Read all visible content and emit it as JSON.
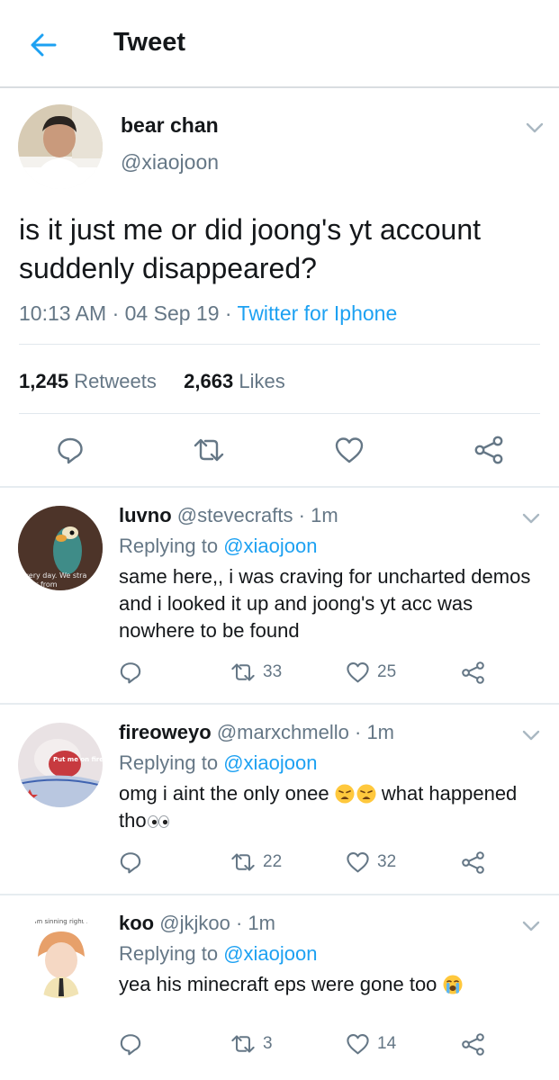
{
  "header": {
    "title": "Tweet",
    "back_icon": "arrow-left-icon"
  },
  "tweet": {
    "name": "bear chan",
    "handle": "@xiaojoon",
    "text": "is it just me or did joong's yt account suddenly disappeared?",
    "time": "10:13 AM",
    "date": "04 Sep 19",
    "source": "Twitter for Iphone",
    "retweets": "1,245",
    "retweets_label": "Retweets",
    "likes": "2,663",
    "likes_label": "Likes"
  },
  "replies": [
    {
      "name": "luvno",
      "handle": "@stevecrafts",
      "time": "1m",
      "replying_label": "Replying to",
      "replying_to": "@xiaojoon",
      "text": "same here,, i was craving for uncharted demos and i looked it up and joong's yt acc was nowhere to be found",
      "avatar_text": "Every day. We stra",
      "avatar_text2": "ther from",
      "retweets": "33",
      "likes": "25"
    },
    {
      "name": "fireoweyo",
      "handle": "@marxchmello",
      "time": "1m",
      "replying_label": "Replying to",
      "replying_to": "@xiaojoon",
      "text_a": "omg i aint the only onee ",
      "text_b": " what happened tho",
      "avatar_text": "Put me on fire",
      "retweets": "22",
      "likes": "32"
    },
    {
      "name": "koo",
      "handle": "@jkjkoo",
      "time": "1m",
      "replying_label": "Replying to",
      "replying_to": "@xiaojoon",
      "text": "yea his minecraft eps were gone too ",
      "avatar_text": ", im sinning right n",
      "retweets": "3",
      "likes": "14"
    }
  ],
  "colors": {
    "accent": "#1da1f2",
    "secondary_text": "#657786",
    "primary_text": "#14171a"
  }
}
